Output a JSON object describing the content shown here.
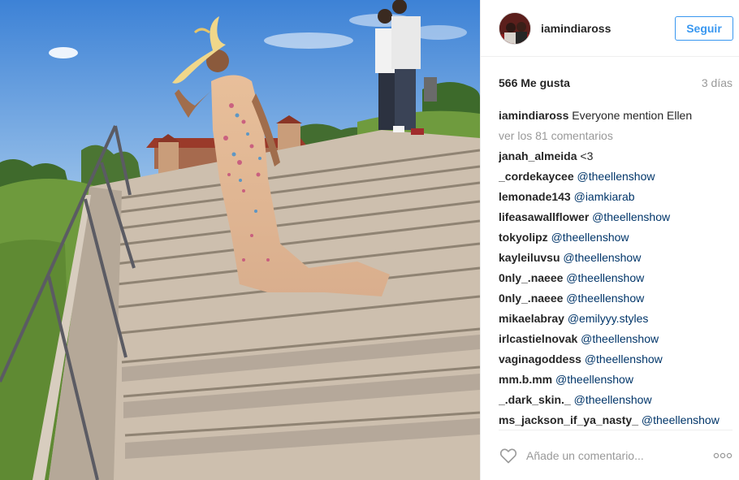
{
  "post": {
    "username": "iamindiaross",
    "follow_label": "Seguir",
    "likes": "566 Me gusta",
    "age": "3 días",
    "caption": {
      "user": "iamindiaross",
      "text": "Everyone mention Ellen"
    },
    "view_all_comments": "ver los 81 comentarios",
    "comments": [
      {
        "user": "janah_almeida",
        "text": "<3"
      },
      {
        "user": "_cordekaycee",
        "mention": "@theellenshow"
      },
      {
        "user": "lemonade143",
        "mention": "@iamkiarab"
      },
      {
        "user": "lifeasawallflower",
        "mention": "@theellenshow"
      },
      {
        "user": "tokyolipz",
        "mention": "@theellenshow"
      },
      {
        "user": "kayleiluvsu",
        "mention": "@theellenshow"
      },
      {
        "user": "0nly_.naeee",
        "mention": "@theellenshow"
      },
      {
        "user": "0nly_.naeee",
        "mention": "@theellenshow"
      },
      {
        "user": "mikaelabray",
        "mention": "@emilyyy.styles"
      },
      {
        "user": "irlcastielnovak",
        "mention": "@theellenshow"
      },
      {
        "user": "vaginagoddess",
        "mention": "@theellenshow"
      },
      {
        "user": "mm.b.mm",
        "mention": "@theellenshow"
      },
      {
        "user": "_.dark_skin._",
        "mention": "@theellenshow"
      },
      {
        "user": "ms_jackson_if_ya_nasty_",
        "mention": "@theellenshow"
      }
    ],
    "add_comment_placeholder": "Añade un comentario...",
    "icons": {
      "like": "heart-outline-icon",
      "options": "more-options-icon"
    }
  },
  "colors": {
    "link_blue": "#3897f0",
    "mention_blue": "#003569",
    "muted_gray": "#999999",
    "text": "#262626"
  }
}
